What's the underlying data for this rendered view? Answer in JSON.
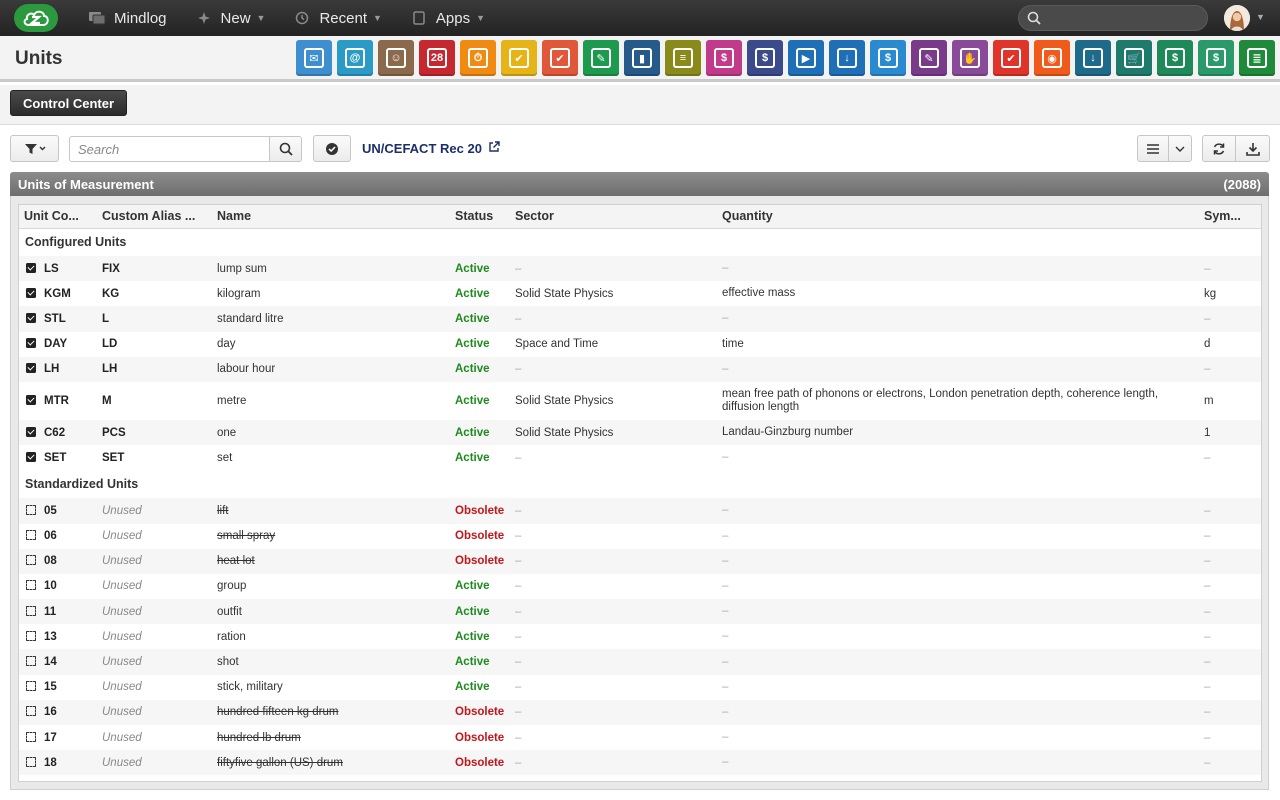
{
  "nav": {
    "brand": "Mindlog",
    "new": "New",
    "recent": "Recent",
    "apps": "Apps",
    "search_placeholder": ""
  },
  "page": {
    "title": "Units"
  },
  "app_icons": [
    {
      "name": "mail-icon",
      "color": "#3e8fcf",
      "glyph": "✉"
    },
    {
      "name": "address-book-icon",
      "color": "#2a9ac7",
      "glyph": "@"
    },
    {
      "name": "contacts-icon",
      "color": "#8a6a4a",
      "glyph": "☺"
    },
    {
      "name": "calendar-icon",
      "color": "#c5282f",
      "glyph": "28"
    },
    {
      "name": "timer-icon",
      "color": "#f08a10",
      "glyph": "⏱"
    },
    {
      "name": "tasks-icon",
      "color": "#e6b417",
      "glyph": "✔"
    },
    {
      "name": "projects-icon",
      "color": "#e0573a",
      "glyph": "✔"
    },
    {
      "name": "notes-icon",
      "color": "#1d9a4d",
      "glyph": "✎"
    },
    {
      "name": "bookmark-icon",
      "color": "#255a8a",
      "glyph": "▮"
    },
    {
      "name": "documents-icon",
      "color": "#8a8a1a",
      "glyph": "≡"
    },
    {
      "name": "pos-icon",
      "color": "#c23a8a",
      "glyph": "$"
    },
    {
      "name": "billing-icon",
      "color": "#3a4a8a",
      "glyph": "$"
    },
    {
      "name": "shipping-icon",
      "color": "#1e6fb5",
      "glyph": "▶"
    },
    {
      "name": "logistics-icon",
      "color": "#1e6fb5",
      "glyph": "↓"
    },
    {
      "name": "payments-icon",
      "color": "#2a8ad0",
      "glyph": "$"
    },
    {
      "name": "contracts-icon",
      "color": "#7a3a8a",
      "glyph": "✎"
    },
    {
      "name": "partners-icon",
      "color": "#8a4a9a",
      "glyph": "✋"
    },
    {
      "name": "pdf-icon",
      "color": "#e0342a",
      "glyph": "✔"
    },
    {
      "name": "broadcast-icon",
      "color": "#f05a1a",
      "glyph": "◉"
    },
    {
      "name": "download-icon",
      "color": "#1e6a8a",
      "glyph": "↓"
    },
    {
      "name": "cart-icon",
      "color": "#1e7a6a",
      "glyph": "🛒"
    },
    {
      "name": "finance-icon",
      "color": "#1e8a5a",
      "glyph": "$"
    },
    {
      "name": "pricing-icon",
      "color": "#2a9a6a",
      "glyph": "$"
    },
    {
      "name": "database-icon",
      "color": "#1e8a3a",
      "glyph": "≣"
    }
  ],
  "control_center": {
    "label": "Control Center"
  },
  "toolbar": {
    "search_placeholder": "Search",
    "uncefact_link": "UN/CEFACT Rec 20"
  },
  "panel": {
    "title": "Units of Measurement",
    "count": "(2088)"
  },
  "table": {
    "columns": [
      "Unit Co...",
      "Custom Alias ...",
      "Name",
      "Status",
      "Sector",
      "Quantity",
      "Sym..."
    ],
    "groups": [
      {
        "label": "Configured Units",
        "rows": [
          {
            "checked": true,
            "code": "LS",
            "alias": "FIX",
            "name": "lump sum",
            "status": "Active",
            "sector": "–",
            "quantity": "–",
            "symbol": "–"
          },
          {
            "checked": true,
            "code": "KGM",
            "alias": "KG",
            "name": "kilogram",
            "status": "Active",
            "sector": "Solid State Physics",
            "quantity": "effective mass",
            "symbol": "kg"
          },
          {
            "checked": true,
            "code": "STL",
            "alias": "L",
            "name": "standard litre",
            "status": "Active",
            "sector": "–",
            "quantity": "–",
            "symbol": "–"
          },
          {
            "checked": true,
            "code": "DAY",
            "alias": "LD",
            "name": "day",
            "status": "Active",
            "sector": "Space and Time",
            "quantity": "time",
            "symbol": "d"
          },
          {
            "checked": true,
            "code": "LH",
            "alias": "LH",
            "name": "labour hour",
            "status": "Active",
            "sector": "–",
            "quantity": "–",
            "symbol": "–"
          },
          {
            "checked": true,
            "code": "MTR",
            "alias": "M",
            "name": "metre",
            "status": "Active",
            "sector": "Solid State Physics",
            "quantity": "mean free path of phonons or electrons, London penetration depth, coherence length, diffusion length",
            "symbol": "m"
          },
          {
            "checked": true,
            "code": "C62",
            "alias": "PCS",
            "name": "one",
            "status": "Active",
            "sector": "Solid State Physics",
            "quantity": "Landau-Ginzburg number",
            "symbol": "1"
          },
          {
            "checked": true,
            "code": "SET",
            "alias": "SET",
            "name": "set",
            "status": "Active",
            "sector": "–",
            "quantity": "–",
            "symbol": "–"
          }
        ]
      },
      {
        "label": "Standardized Units",
        "rows": [
          {
            "checked": false,
            "code": "05",
            "alias": "Unused",
            "name": "lift",
            "status": "Obsolete",
            "sector": "–",
            "quantity": "–",
            "symbol": "–"
          },
          {
            "checked": false,
            "code": "06",
            "alias": "Unused",
            "name": "small spray",
            "status": "Obsolete",
            "sector": "–",
            "quantity": "–",
            "symbol": "–"
          },
          {
            "checked": false,
            "code": "08",
            "alias": "Unused",
            "name": "heat lot",
            "status": "Obsolete",
            "sector": "–",
            "quantity": "–",
            "symbol": "–"
          },
          {
            "checked": false,
            "code": "10",
            "alias": "Unused",
            "name": "group",
            "status": "Active",
            "sector": "–",
            "quantity": "–",
            "symbol": "–"
          },
          {
            "checked": false,
            "code": "11",
            "alias": "Unused",
            "name": "outfit",
            "status": "Active",
            "sector": "–",
            "quantity": "–",
            "symbol": "–"
          },
          {
            "checked": false,
            "code": "13",
            "alias": "Unused",
            "name": "ration",
            "status": "Active",
            "sector": "–",
            "quantity": "–",
            "symbol": "–"
          },
          {
            "checked": false,
            "code": "14",
            "alias": "Unused",
            "name": "shot",
            "status": "Active",
            "sector": "–",
            "quantity": "–",
            "symbol": "–"
          },
          {
            "checked": false,
            "code": "15",
            "alias": "Unused",
            "name": "stick, military",
            "status": "Active",
            "sector": "–",
            "quantity": "–",
            "symbol": "–"
          },
          {
            "checked": false,
            "code": "16",
            "alias": "Unused",
            "name": "hundred fifteen kg drum",
            "status": "Obsolete",
            "sector": "–",
            "quantity": "–",
            "symbol": "–"
          },
          {
            "checked": false,
            "code": "17",
            "alias": "Unused",
            "name": "hundred lb drum",
            "status": "Obsolete",
            "sector": "–",
            "quantity": "–",
            "symbol": "–"
          },
          {
            "checked": false,
            "code": "18",
            "alias": "Unused",
            "name": "fiftyfive gallon (US) drum",
            "status": "Obsolete",
            "sector": "–",
            "quantity": "–",
            "symbol": "–"
          }
        ]
      }
    ]
  }
}
